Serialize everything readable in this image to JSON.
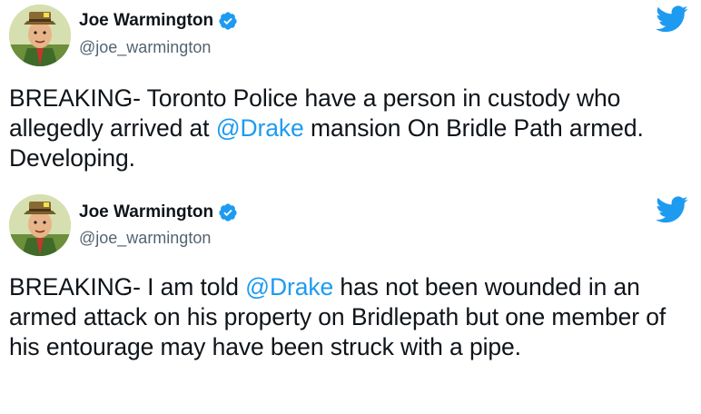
{
  "tweets": [
    {
      "author_name": "Joe Warmington",
      "handle": "@joe_warmington",
      "text_before": "BREAKING- Toronto Police have a person in custody who allegedly arrived at ",
      "mention": "@Drake",
      "text_after": " mansion On Bridle Path armed. Developing."
    },
    {
      "author_name": "Joe Warmington",
      "handle": "@joe_warmington",
      "text_before": "BREAKING- I am told ",
      "mention": "@Drake",
      "text_after": " has not been wounded in an armed attack on his property on Bridlepath but one member of his entourage may have been struck with a pipe."
    }
  ],
  "icons": {
    "verified": "verified-badge-icon",
    "brand": "twitter-bird-icon"
  },
  "colors": {
    "accent": "#1d9bf0",
    "text": "#0f1419",
    "secondary": "#536471"
  }
}
